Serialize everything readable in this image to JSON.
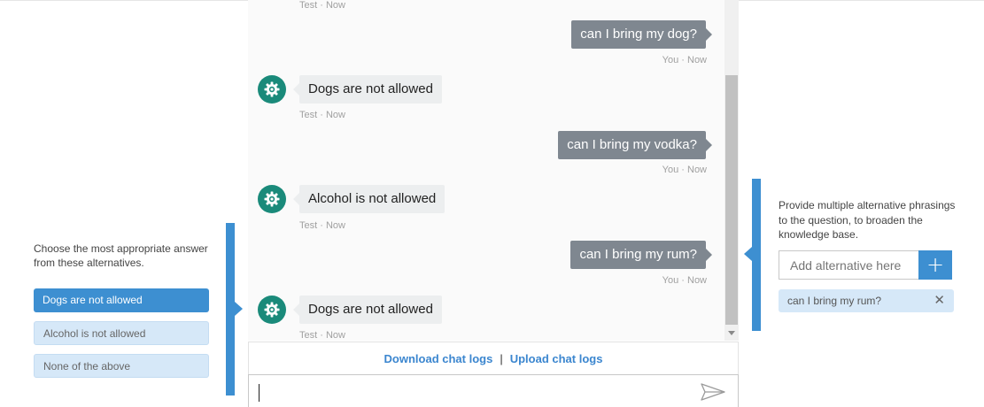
{
  "left_panel": {
    "description": "Choose the most appropriate answer from these alternatives.",
    "choices": [
      {
        "label": "Dogs are not allowed",
        "selected": true
      },
      {
        "label": "Alcohol is not allowed",
        "selected": false
      },
      {
        "label": "None of the above",
        "selected": false
      }
    ]
  },
  "chat": {
    "messages": [
      {
        "from": "bot-meta",
        "meta": "Test · Now"
      },
      {
        "from": "user",
        "text": "can I bring my dog?",
        "meta": "You · Now"
      },
      {
        "from": "bot",
        "text": "Dogs are not allowed",
        "meta": "Test · Now"
      },
      {
        "from": "user",
        "text": "can I bring my vodka?",
        "meta": "You · Now"
      },
      {
        "from": "bot",
        "text": "Alcohol is not allowed",
        "meta": "Test · Now"
      },
      {
        "from": "user",
        "text": "can I bring my rum?",
        "meta": "You · Now"
      },
      {
        "from": "bot",
        "text": "Dogs are not allowed",
        "meta": "Test · Now"
      }
    ],
    "download_link": "Download chat logs",
    "separator": "|",
    "upload_link": "Upload chat logs",
    "input_value": ""
  },
  "right_panel": {
    "description": "Provide multiple alternative phrasings to the question, to broaden the knowledge base.",
    "input_placeholder": "Add alternative here",
    "add_button": "+",
    "alternatives": [
      {
        "label": "can I bring my rum?",
        "close": "✕"
      }
    ]
  },
  "colors": {
    "accent": "#3d8fd1",
    "user_bubble": "#7f8790",
    "bot_bubble": "#eceeef",
    "bot_avatar": "#1a8a7a",
    "chip": "#d6e8f8"
  }
}
